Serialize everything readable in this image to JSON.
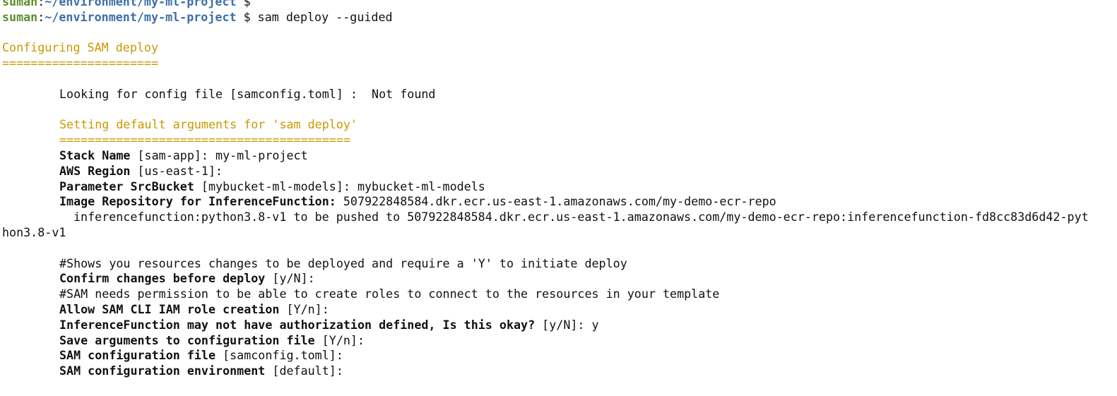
{
  "terminal": {
    "prompt1": {
      "user": "suman",
      "sep": ":",
      "path": "~/environment/my-ml-project",
      "symbol": " $",
      "command": ""
    },
    "prompt2": {
      "user": "suman",
      "sep": ":",
      "path": "~/environment/my-ml-project",
      "symbol": " $",
      "command": " sam deploy --guided"
    },
    "section_title": "Configuring SAM deploy",
    "section_rule": "======================",
    "config_lookup": "Looking for config file [samconfig.toml] :  Not found",
    "defaults_title": "Setting default arguments for 'sam deploy'",
    "defaults_rule": "=========================================",
    "stack_name": {
      "label": "Stack Name",
      "rest": " [sam-app]: my-ml-project"
    },
    "aws_region": {
      "label": "AWS Region",
      "rest": " [us-east-1]:"
    },
    "param_bucket": {
      "label": "Parameter SrcBucket",
      "rest": " [mybucket-ml-models]: mybucket-ml-models"
    },
    "image_repo": {
      "label": "Image Repository for InferenceFunction:",
      "rest": " 507922848584.dkr.ecr.us-east-1.amazonaws.com/my-demo-ecr-repo"
    },
    "push_line1": "inferencefunction:python3.8-v1 to be pushed to 507922848584.dkr.ecr.us-east-1.amazonaws.com/my-demo-ecr-repo:inferencefunction-fd8cc83d6d42-pyt",
    "push_line2": "hon3.8-v1",
    "comment_changes": "#Shows you resources changes to be deployed and require a 'Y' to initiate deploy",
    "confirm_changes": {
      "label": "Confirm changes before deploy",
      "rest": " [y/N]:"
    },
    "comment_iam": "#SAM needs permission to be able to create roles to connect to the resources in your template",
    "allow_iam": {
      "label": "Allow SAM CLI IAM role creation",
      "rest": " [Y/n]:"
    },
    "auth_question": {
      "label": "InferenceFunction may not have authorization defined, Is this okay?",
      "rest": " [y/N]: y"
    },
    "save_args": {
      "label": "Save arguments to configuration file",
      "rest": " [Y/n]:"
    },
    "config_file": {
      "label": "SAM configuration file",
      "rest": " [samconfig.toml]:"
    },
    "config_env": {
      "label": "SAM configuration environment",
      "rest": " [default]:"
    }
  }
}
